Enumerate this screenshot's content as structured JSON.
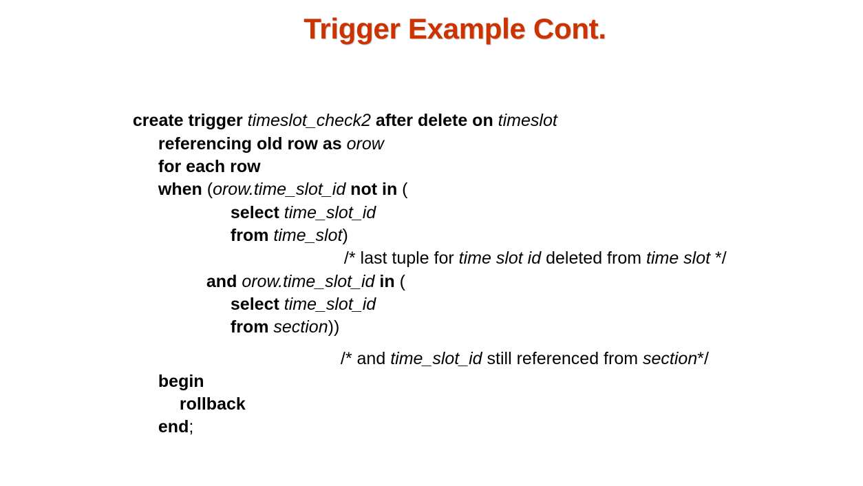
{
  "slide": {
    "title": "Trigger Example Cont.",
    "title_color": "#cc3300"
  },
  "code": {
    "l1": {
      "kw1": "create trigger ",
      "id1": "timeslot_check2",
      "kw2": " after delete on ",
      "id2": "timeslot"
    },
    "l2": {
      "kw1": "referencing old row as ",
      "id1": "orow"
    },
    "l3": {
      "kw1": "for each row"
    },
    "l4": {
      "kw1": "when ",
      "pl1": "(",
      "id1": "orow.time_slot_id",
      "kw2": " not in ",
      "pl2": "("
    },
    "l5": {
      "kw1": "select ",
      "id1": "time_slot_id"
    },
    "l6": {
      "kw1": "from ",
      "id1": "time_slot",
      "pl1": ")"
    },
    "l7": {
      "pl1": "/* last tuple for ",
      "id1": "time slot id",
      "pl2": " deleted from ",
      "id2": "time slot",
      "pl3": " */"
    },
    "l8": {
      "kw1": "and ",
      "id1": "orow.time_slot_id",
      "kw2": " in ",
      "pl1": "("
    },
    "l9": {
      "kw1": "select ",
      "id1": "time_slot_id"
    },
    "l10": {
      "kw1": "from ",
      "id1": "section",
      "pl1": "))"
    },
    "l11": {
      "pl1": "/* and ",
      "id1": "time_slot_id",
      "pl2": " still referenced from ",
      "id2": "section",
      "pl3": "*/"
    },
    "l12": {
      "kw1": "begin"
    },
    "l13": {
      "kw1": "rollback"
    },
    "l14": {
      "kw1": "end",
      "pl1": ";"
    }
  }
}
